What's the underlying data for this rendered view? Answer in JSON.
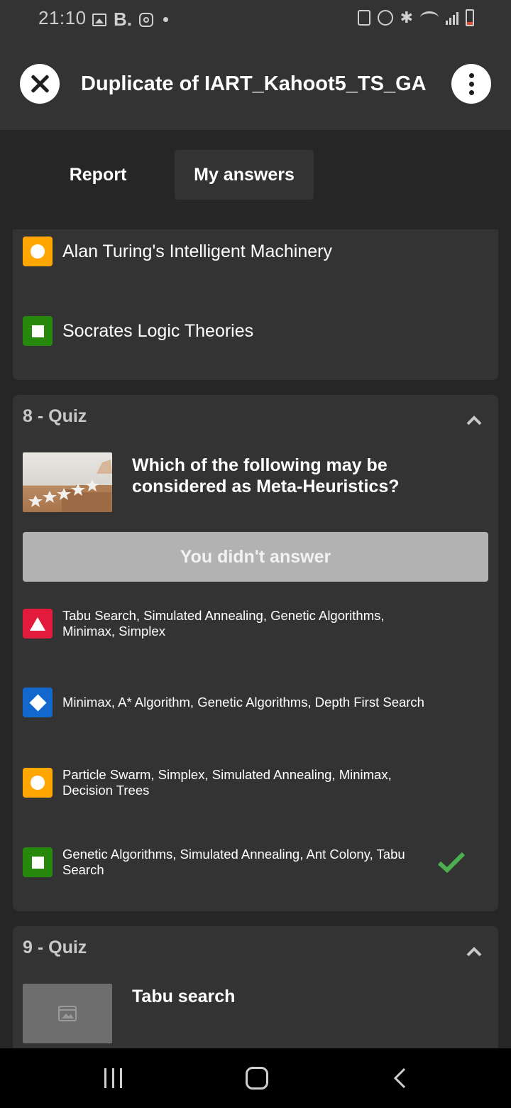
{
  "status_bar": {
    "time": "21:10",
    "notification_letter": "B."
  },
  "header": {
    "title": "Duplicate of IART_Kahoot5_TS_GA"
  },
  "tabs": [
    {
      "label": "Report",
      "active": false
    },
    {
      "label": "My answers",
      "active": true
    }
  ],
  "previous_question": {
    "answers": [
      {
        "shape": "circle",
        "color": "#ffa602",
        "text": "Alan Turing's Intelligent Machinery"
      },
      {
        "shape": "square",
        "color": "#26890c",
        "text": "Socrates Logic Theories"
      }
    ]
  },
  "quiz8": {
    "label": "8 - Quiz",
    "question": "Which of the following may be considered as Meta-Heuristics?",
    "status": "You didn't answer",
    "answers": [
      {
        "shape": "triangle",
        "color": "#e21b3c",
        "text": "Tabu Search, Simulated Annealing, Genetic Algorithms, Minimax, Simplex",
        "correct": false
      },
      {
        "shape": "diamond",
        "color": "#1368ce",
        "text": "Minimax, A* Algorithm, Genetic Algorithms, Depth First Search",
        "correct": false
      },
      {
        "shape": "circle",
        "color": "#ffa602",
        "text": "Particle Swarm, Simplex, Simulated Annealing, Minimax, Decision Trees",
        "correct": false
      },
      {
        "shape": "square",
        "color": "#26890c",
        "text": "Genetic Algorithms, Simulated Annealing, Ant Colony, Tabu Search",
        "correct": true
      }
    ]
  },
  "quiz9": {
    "label": "9 - Quiz",
    "question": "Tabu search"
  },
  "colors": {
    "correct_check": "#4caf50",
    "card_bg": "#333333",
    "page_bg": "#262626"
  }
}
